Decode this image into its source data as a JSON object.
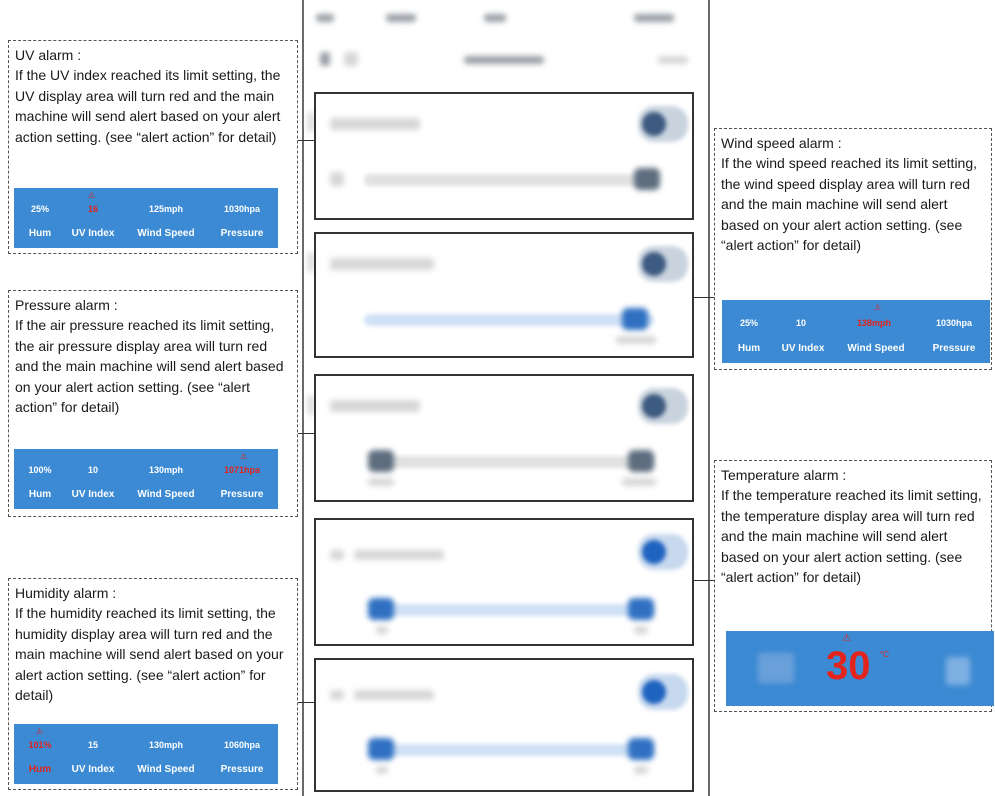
{
  "uv_note": {
    "title": "UV alarm :",
    "text": "If the UV index reached its limit setting, the UV display area will turn red and the main machine will send alert based on your alert action setting. (see “alert action” for detail)",
    "strip": {
      "values": [
        "25%",
        "16",
        "125mph",
        "1030hpa"
      ],
      "labels": [
        "Hum",
        "UV Index",
        "Wind Speed",
        "Pressure"
      ],
      "alert_index": 1
    }
  },
  "pressure_note": {
    "title": "Pressure alarm :",
    "text": "If the air pressure reached its limit setting, the air pressure display area will turn red and the main machine will send alert based on your alert action setting. (see “alert action” for detail)",
    "strip": {
      "values": [
        "100%",
        "10",
        "130mph",
        "1071hpa"
      ],
      "labels": [
        "Hum",
        "UV Index",
        "Wind Speed",
        "Pressure"
      ],
      "alert_index": 3
    }
  },
  "humidity_note": {
    "title": "Humidity alarm :",
    "text": "If the humidity reached its limit setting, the humidity display area will turn red and the main machine will send alert based on your alert action setting. (see “alert action” for detail)",
    "strip": {
      "values": [
        "101%",
        "15",
        "130mph",
        "1060hpa"
      ],
      "labels": [
        "Hum",
        "UV Index",
        "Wind Speed",
        "Pressure"
      ],
      "alert_index": 0
    }
  },
  "wind_note": {
    "title": "Wind speed alarm :",
    "text": "If the wind speed reached its limit setting, the wind speed display area will turn red and the main machine will send alert based on your alert action setting. (see “alert action” for detail)",
    "strip": {
      "values": [
        "25%",
        "10",
        "138mph",
        "1030hpa"
      ],
      "labels": [
        "Hum",
        "UV Index",
        "Wind Speed",
        "Pressure"
      ],
      "alert_index": 2
    }
  },
  "temperature_note": {
    "title": "Temperature alarm :",
    "text": "If the temperature reached its limit setting, the temperature display area will turn red and the main machine will send alert based on your alert action setting. (see “alert action” for detail)",
    "value": "30",
    "unit": "°C"
  },
  "colors": {
    "strip_blue": "#3b8ad3",
    "alert_red": "#e3241c"
  },
  "icons": {
    "warning": "warning-icon"
  }
}
